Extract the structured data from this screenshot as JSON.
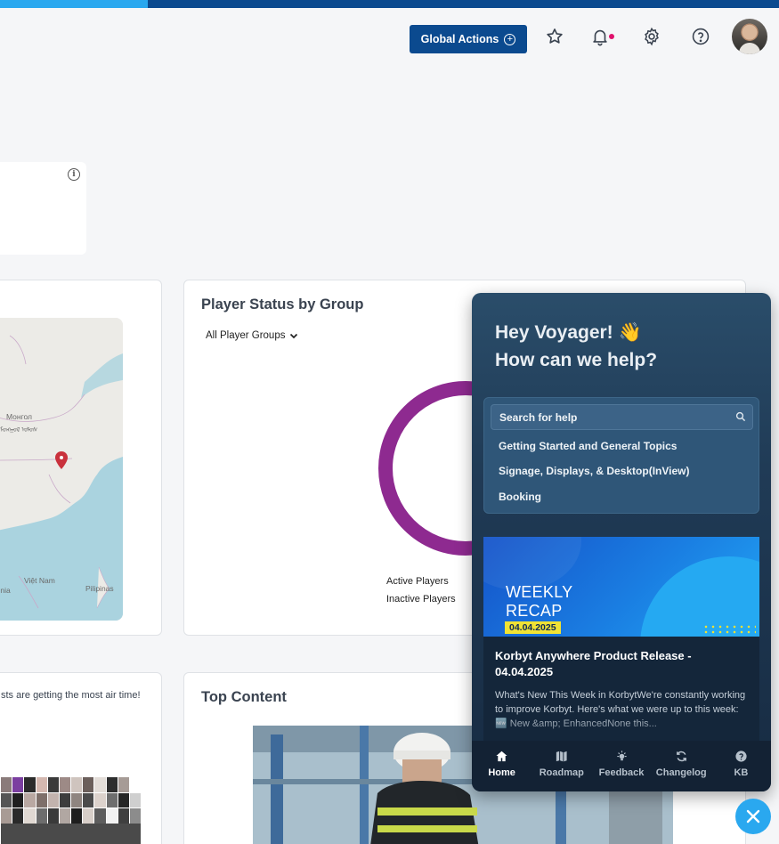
{
  "progress": {
    "fraction": 0.19
  },
  "topbar": {
    "global_actions_label": "Global Actions",
    "icons": [
      "star-icon",
      "bell-icon",
      "gear-icon",
      "help-icon"
    ],
    "has_unread_notification": true
  },
  "map_card": {
    "labels": [
      "Монгол",
      "ᠮᠣᠩᠭᠣᠯ ᠤᠯᠤᠰ",
      "Việt Nam",
      "Pilipinas",
      "Inia"
    ]
  },
  "player_status": {
    "title": "Player Status by Group",
    "group_filter": "All Player Groups",
    "legend": [
      "Active Players",
      "Inactive Players"
    ],
    "donut_color": "#8e2a90"
  },
  "most_air_time": {
    "text": "sts are getting the most air time!"
  },
  "top_content": {
    "title": "Top Content"
  },
  "help": {
    "greeting_line1": "Hey Voyager! 👋",
    "greeting_line2": "How can we help?",
    "search_placeholder": "Search for help",
    "topics": [
      "Getting Started and General Topics",
      "Signage, Displays, & Desktop(InView)",
      "Booking"
    ],
    "recap": {
      "banner_line1": "WEEKLY",
      "banner_line2": "RECAP",
      "banner_date": "04.04.2025",
      "title": "Korbyt Anywhere Product Release - 04.04.2025",
      "body": "What's New This Week in KorbytWe're constantly working to improve Korbyt. Here's what we were up to this week: 🆕 New &amp; EnhancedNone this..."
    },
    "nav": [
      {
        "label": "Home",
        "icon": "home-icon",
        "active": true
      },
      {
        "label": "Roadmap",
        "icon": "roadmap-icon",
        "active": false
      },
      {
        "label": "Feedback",
        "icon": "lightbulb-icon",
        "active": false
      },
      {
        "label": "Changelog",
        "icon": "refresh-icon",
        "active": false
      },
      {
        "label": "KB",
        "icon": "question-icon",
        "active": false
      }
    ]
  },
  "colors": {
    "brand_navy": "#0b4a8f",
    "accent_blue": "#2aa8ef",
    "notification_dot": "#e0116c",
    "recap_date_bg": "#f0e234"
  }
}
